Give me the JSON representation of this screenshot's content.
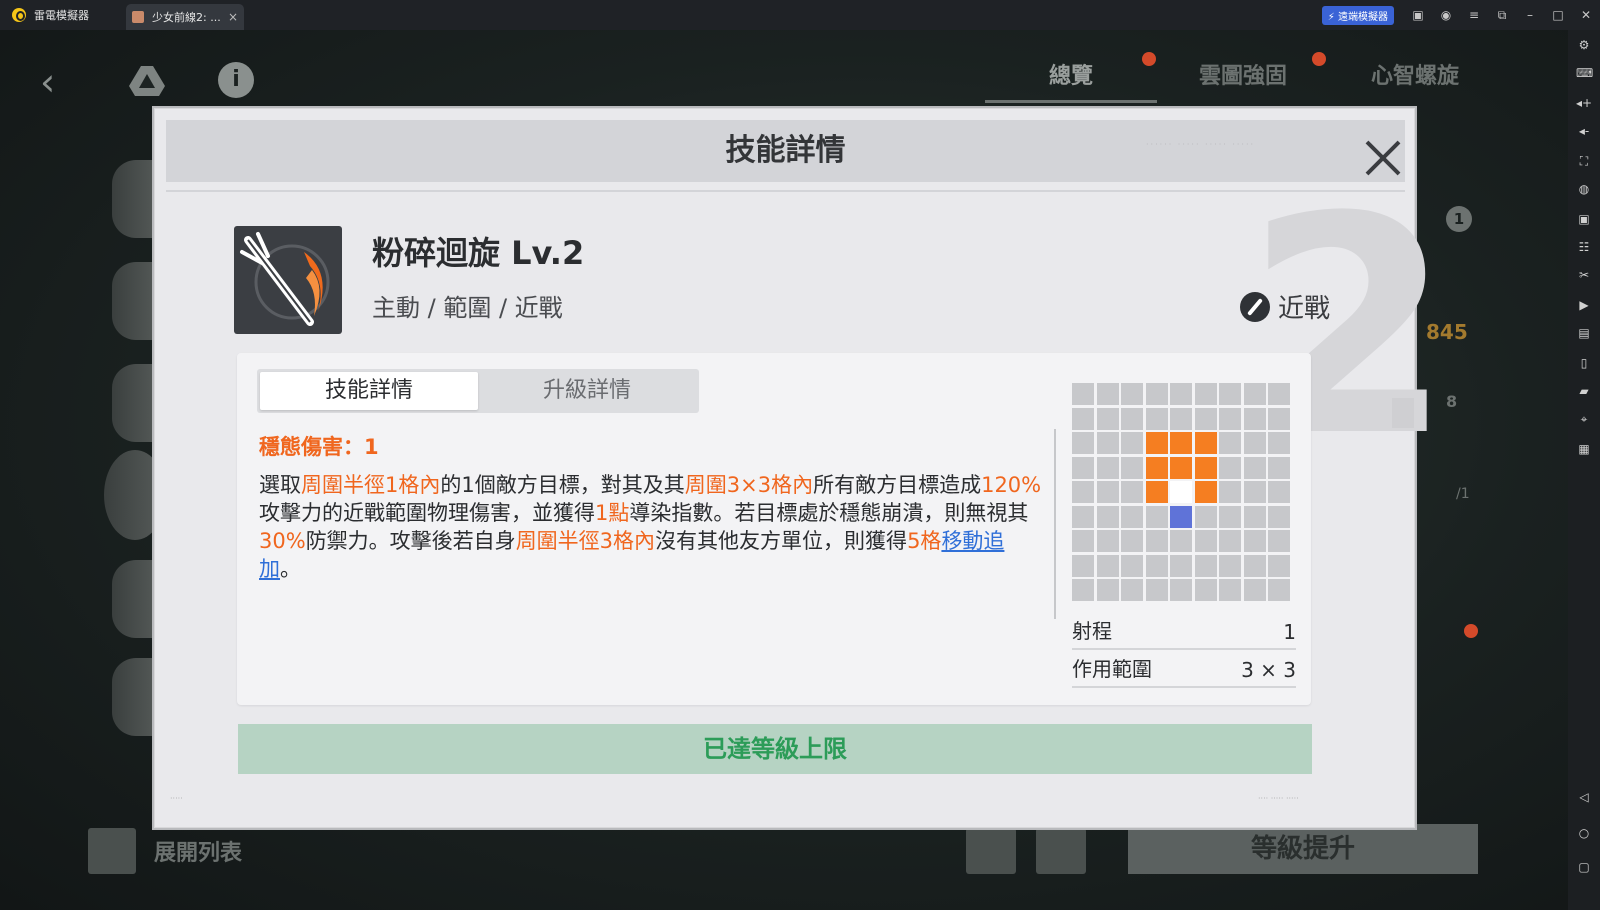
{
  "titlebar": {
    "app_name": "雷電模擬器",
    "tab_title": "少女前線2: ...",
    "tab_close": "×",
    "remote_label": "遠端模擬器",
    "icons": [
      "gift-icon",
      "user-icon",
      "menu-icon",
      "popout-icon",
      "minimize-icon",
      "maximize-icon",
      "close-icon"
    ]
  },
  "sidebar": {
    "icons": [
      "gear-icon",
      "keyboard-icon",
      "volume-up-icon",
      "volume-down-icon",
      "screenshot-icon",
      "shake-icon",
      "record-icon",
      "robot-icon",
      "scissors-icon",
      "video-icon",
      "multi-instance-icon",
      "sync-icon",
      "folder-icon",
      "location-icon",
      "apk-icon",
      "back-icon",
      "home-icon",
      "recent-apps-icon"
    ]
  },
  "background": {
    "tabs": [
      "總覽",
      "雲圖強固",
      "心智螺旋"
    ],
    "number_845": "845",
    "number_1": "1",
    "number_8": "8",
    "number_1_over": "/1",
    "expand_list": "展開列表",
    "level_up": "等級提升"
  },
  "dialog": {
    "title": "技能詳情",
    "watermark": "2",
    "skill": {
      "name": "粉碎迴旋 Lv.2",
      "tags": "主動 / 範圍 / 近戰",
      "type": "近戰"
    },
    "tabs": [
      "技能詳情",
      "升級詳情"
    ],
    "active_tab": 0,
    "stance_damage": "穩態傷害：1",
    "description": {
      "seg01": "選取",
      "seg02": "周圍半徑1格內",
      "seg03": "的1個敵方目標，對其及其",
      "seg04": "周圍3×3格內",
      "seg05": "所有敵方目標造成",
      "seg06": "120%",
      "seg07": "攻擊力的近戰範圍物理傷害，並獲得",
      "seg08": "1點",
      "seg09": "導染指數。若目標處於穩態崩潰，則無視其",
      "seg10": "30%",
      "seg11": "防禦力。攻擊後若自身",
      "seg12": "周圍半徑3格內",
      "seg13": "沒有其他友方單位，則獲得",
      "seg14": "5格",
      "seg15": "移動追加",
      "seg16": "。"
    },
    "range_grid": {
      "cols": 9,
      "rows": 9,
      "area": [
        [
          2,
          3
        ],
        [
          2,
          4
        ],
        [
          2,
          5
        ],
        [
          3,
          3
        ],
        [
          3,
          4
        ],
        [
          3,
          5
        ],
        [
          4,
          3
        ],
        [
          4,
          5
        ]
      ],
      "self": [
        4,
        4
      ],
      "target": [
        5,
        4
      ]
    },
    "stats": {
      "range_label": "射程",
      "range_value": "1",
      "area_label": "作用範圍",
      "area_value": "3 × 3"
    },
    "max_level_label": "已達等級上限"
  },
  "colors": {
    "highlight": "#f0661e",
    "link": "#2f6fd8",
    "area_cell": "#f57e21",
    "target_cell": "#5f73d8",
    "maxed_text": "#2c9c58"
  }
}
